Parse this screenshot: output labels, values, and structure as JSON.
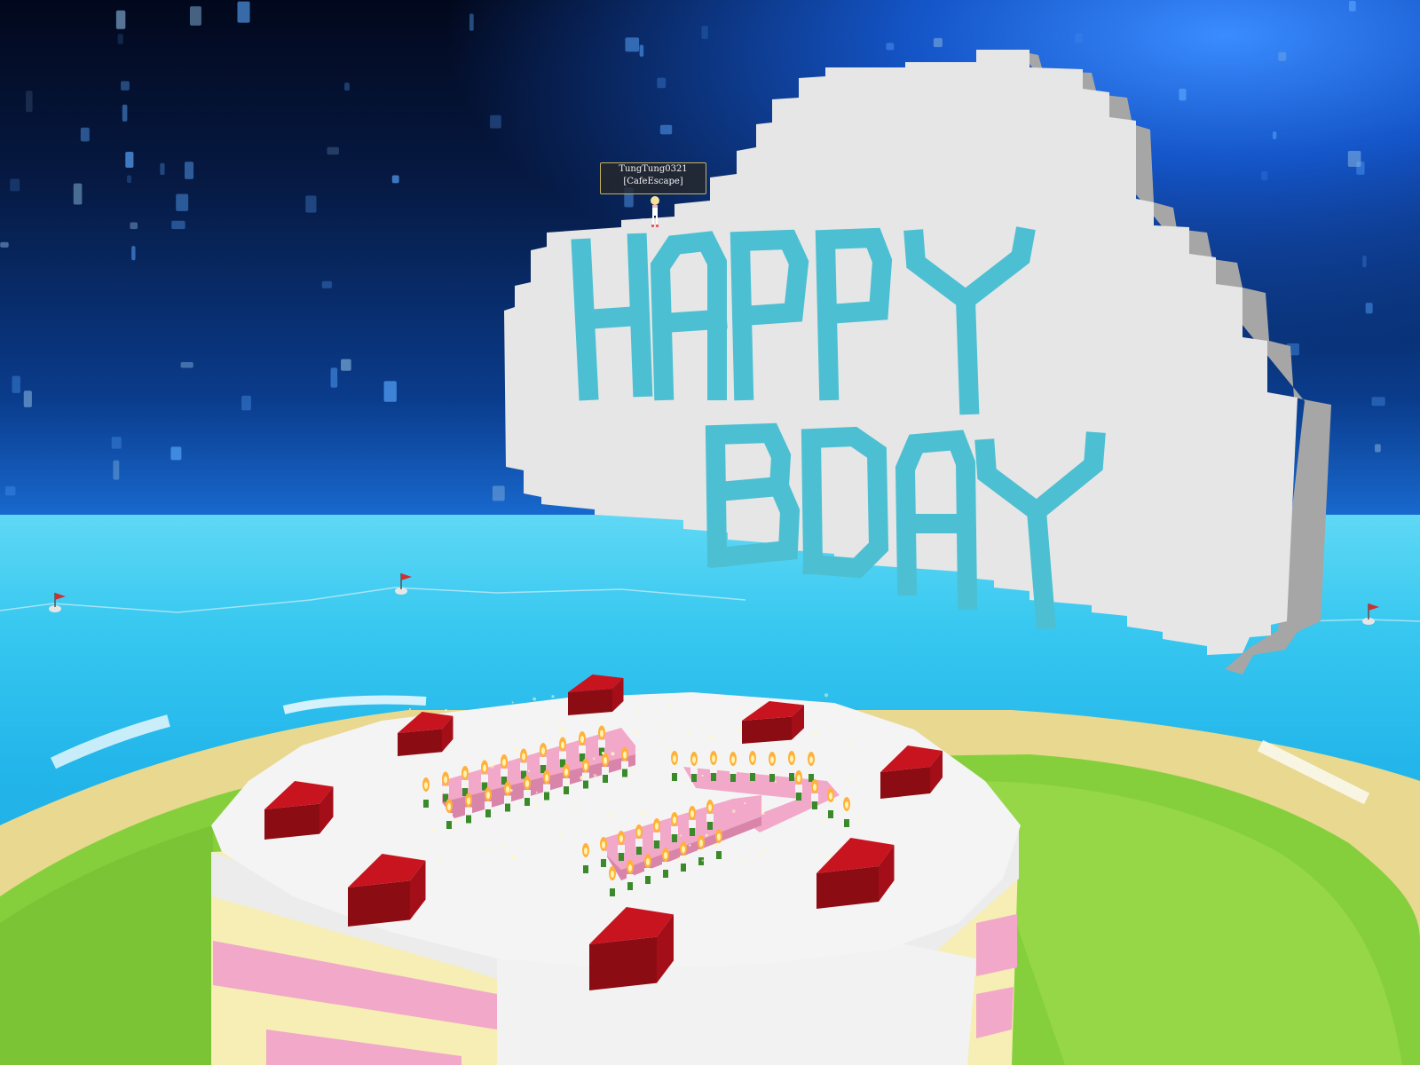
{
  "scene": {
    "sign_text_line1": "HAPPY",
    "sign_text_line2": "BDAY"
  },
  "player": {
    "name": "TungTung0321",
    "guild": "[CafeEscape]"
  },
  "cake": {
    "number": "17"
  },
  "colors": {
    "sign_letters": "#4cc0d2",
    "sign_board": "#e6e6e6",
    "frosting": "#f4f4f4",
    "strawberry_block": "#c8141e",
    "pink_layer": "#f2a8c8",
    "yellow_layer": "#f6eeb4",
    "sea": "#23b6ea",
    "grass": "#7ac83a"
  }
}
